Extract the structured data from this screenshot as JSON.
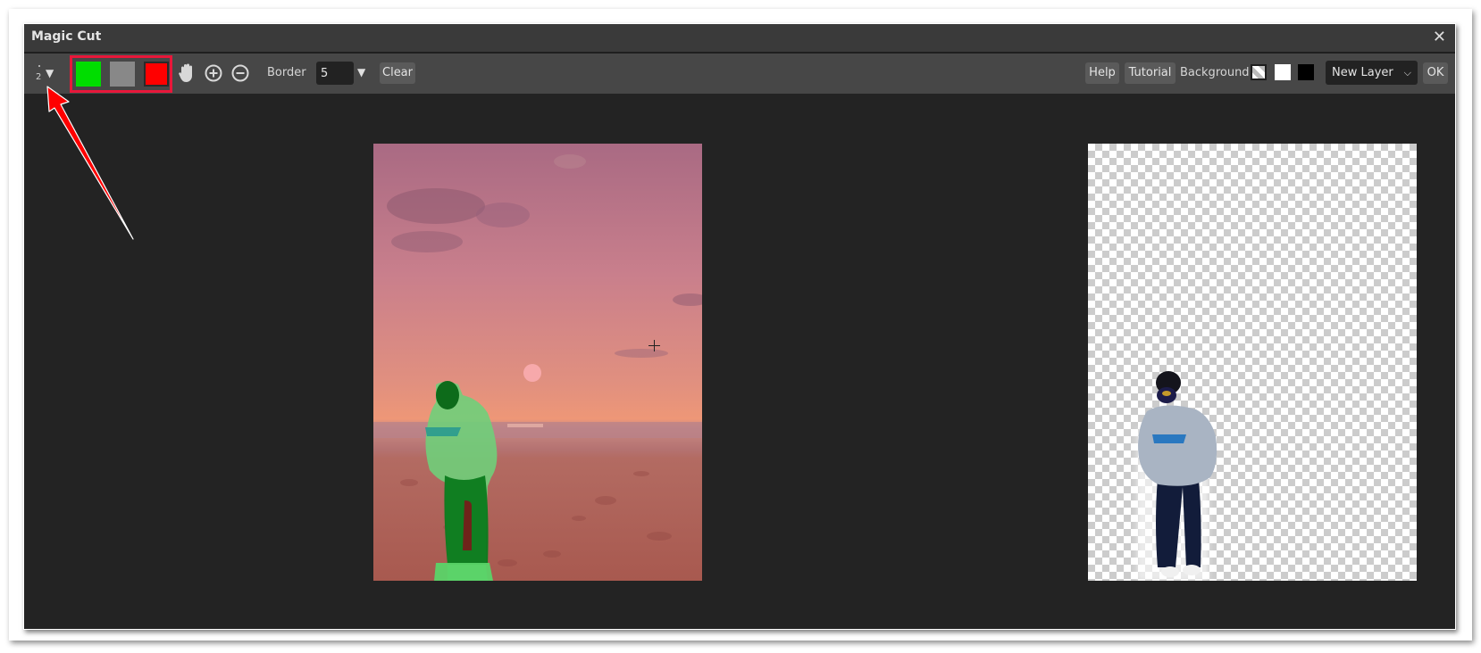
{
  "dialog": {
    "title": "Magic Cut",
    "close_icon": "close-icon",
    "close_glyph": "✕"
  },
  "toolbar": {
    "brush_size": "2",
    "brush_dropdown_glyph": "▼",
    "brush_colors": [
      {
        "name": "foreground-keep",
        "color": "#00dd00"
      },
      {
        "name": "unknown-gray",
        "color": "#888888"
      },
      {
        "name": "background-remove",
        "color": "#ff0000"
      }
    ],
    "selected_brush_index": 2,
    "highlight_color": "#e8173a",
    "hand_icon": "hand-pan-icon",
    "zoom_in_icon": "zoom-in-icon",
    "zoom_out_icon": "zoom-out-icon",
    "border_label": "Border",
    "border_value": "5",
    "border_dropdown_glyph": "▼",
    "clear_label": "Clear",
    "help_label": "Help",
    "tutorial_label": "Tutorial",
    "background_label": "Background:",
    "background_options": [
      "transparent",
      "white",
      "black"
    ],
    "selected_background": "transparent",
    "output_select": "New Layer",
    "output_select_chevron": "⌄",
    "ok_label": "OK"
  },
  "canvas": {
    "left_image": "beach-sunset-photo-with-mask-overlay",
    "right_image": "cutout-preview-person-on-transparent"
  },
  "annotation": {
    "arrow_color": "#ff0000",
    "points_to": "brush-size-dropdown"
  }
}
